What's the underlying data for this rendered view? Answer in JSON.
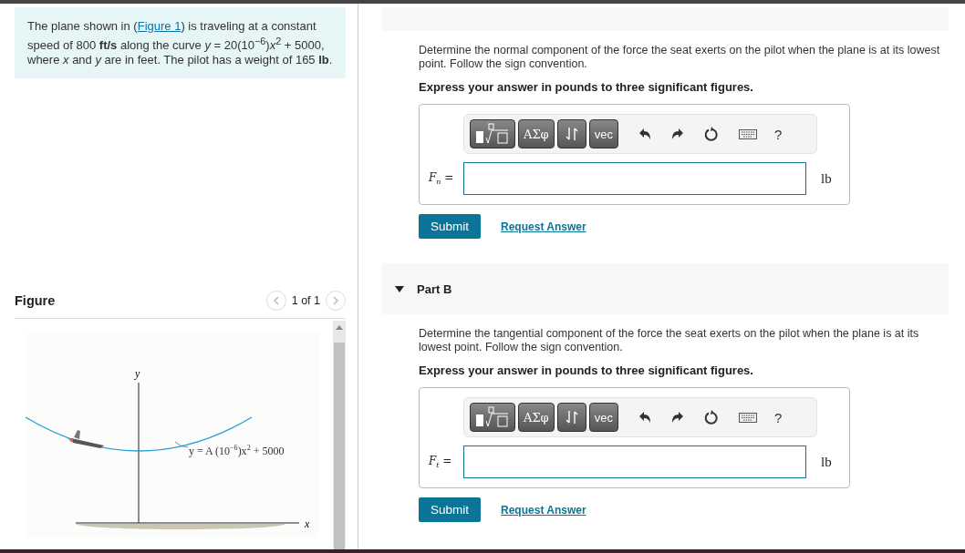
{
  "problem": {
    "before": "The plane shown in (",
    "link": "Figure 1",
    "after": ") is traveling at a constant speed of 800 **ft/s** along the curve *y* = 20(10$^{−6}$)*x*$^{2}$ + 5000, where *x* and *y* are in feet. The pilot has a weight of 165 **lb**."
  },
  "figure": {
    "title": "Figure",
    "pager": "1 of 1",
    "y_axis": "y",
    "x_axis": "x",
    "curve_label": "y = A (10$^{−6}$)x$^{2}$ + 5000"
  },
  "parts": [
    {
      "prompt": "Determine the normal component of the force the seat exerts on the pilot when the plane is at its lowest point. Follow the sign convention.",
      "instruction": "Express your answer in pounds to three significant figures.",
      "toolbar": [
        "ΑΣφ",
        "vec",
        "?"
      ],
      "variable": "F$_{n}$ =",
      "unit": "lb",
      "submit": "Submit",
      "request": "Request Answer"
    },
    {
      "header": "Part B",
      "expanded": true,
      "prompt": "Determine the tangential component of the force the seat exerts on the pilot when the plane is at its lowest point. Follow the sign convention.",
      "instruction": "Express your answer in pounds to three significant figures.",
      "toolbar": [
        "ΑΣφ",
        "vec",
        "?"
      ],
      "variable": "F$_{t}$ =",
      "unit": "lb",
      "submit": "Submit",
      "request": "Request Answer"
    }
  ]
}
